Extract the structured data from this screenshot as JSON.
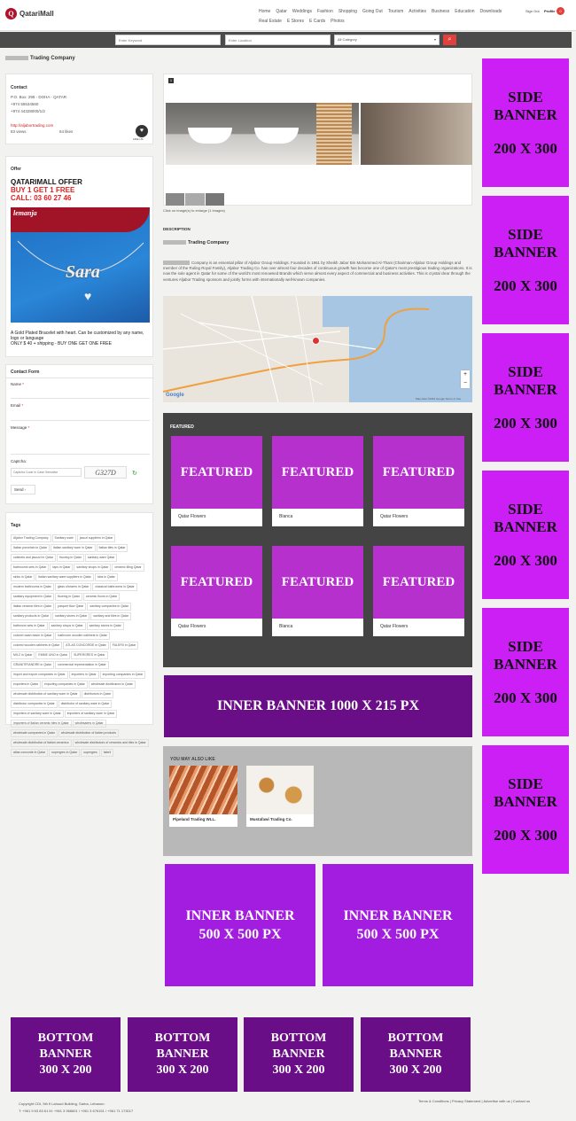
{
  "header": {
    "logo_text": "QatariMall",
    "logo_letter": "Q",
    "nav": [
      "Home",
      "Qatar",
      "Weddings",
      "Fashion",
      "Shopping",
      "Going Out",
      "Tourism",
      "Activities",
      "Business",
      "Education",
      "Downloads",
      "Real Estate",
      "E Stores",
      "E Cards",
      "Photos"
    ],
    "sign_out": "Sign Out",
    "profile": "Profile",
    "profile_badge": "0"
  },
  "search": {
    "keyword_placeholder": "Enter Keyword",
    "location_placeholder": "Enter Location",
    "category": "All Category"
  },
  "page": {
    "title_suffix": "Trading Company"
  },
  "contact": {
    "heading": "Contact",
    "address": "P.O. Box: 295 - DOHA - QATAR",
    "phone1": "+974 55534560",
    "phone2": "+974 44328000/1/2",
    "email": "",
    "website": "http://aljabortrading.com",
    "views": "83 views",
    "likes": "64 likes",
    "like_label": "LIKE US"
  },
  "offer": {
    "heading": "Offer",
    "title": "QATARIMALL OFFER",
    "line1": "BUY 1 GET 1 FREE",
    "line2": "CALL: 03 60 27 46",
    "brand": "lemanja",
    "pendant": "Sara",
    "desc1": "A Gold Plated Bracelet with heart. Can be customized by any name, logo or language",
    "desc2": "ONLY $ 40 + shipping - BUY ONE GET ONE FREE"
  },
  "form": {
    "heading": "Contact Form",
    "name": "Name",
    "email": "Email",
    "message": "Message",
    "captcha": "Captcha:",
    "captcha_placeholder": "Captcha Code is Case Sensitive",
    "captcha_code": "G327D",
    "send": "Send"
  },
  "tags": {
    "heading": "Tags",
    "items": [
      "Aljabor Trading Company",
      "Sanitary ware",
      "jacuzi suppliers in Qatar",
      "Italian porcelain in Qatar",
      "Italian sanitary ware in Qatar",
      "Italian tiles in Qatar",
      "cabinets and jacuzzi in Qatar",
      "flooring in Qatar",
      "sanitary ware Qatar",
      "bathrooms sets in Qatar",
      "taps in Qatar",
      "sanitary shops in Qatar",
      "ceramic tiling Qatar",
      "sinks in Qatar",
      "italian sanitary ware suppliers in Qatar",
      "tubs in Qatar",
      "modern bathrooms in Qatar",
      "glass showers in Qatar",
      "classical bathrooms in Qatar",
      "sanitary equipment in Qatar",
      "flooring in Qatar",
      "ceramic floors in Qatar",
      "italian ceramic tiles in Qatar",
      "parquet floor Qatar",
      "sanitary companies in Qatar",
      "sanitary products in Qatar",
      "sanitary stores in Qatar",
      "sanitary and tiles in Qatar",
      "bathroom sets in Qatar",
      "sanitary shops in Qatar",
      "sanitary stores in Qatar",
      "colored wash basin in Qatar",
      "bathroom wooden cabinets in Qatar",
      "colored wooden cabinets in Qatar",
      "ATLAS CONCORDE in Qatar",
      "FALERII in Qatar",
      "MILZ in Qatar",
      "EMME UNO in Qatar",
      "SUPERGRES in Qatar",
      "GRANITIFIANDRE in Qatar",
      "commercial representation in Qatar",
      "import and export companies in Qatar",
      "importers in Qatar",
      "importing companies in Qatar",
      "exporters in Qatar",
      "exporting companies in Qatar",
      "wholesale distributors in Qatar",
      "wholesale distribution of sanitary ware in Qatar",
      "distributors in Qatar",
      "distributor companies in Qatar",
      "distributor of sanitary ware in Qatar",
      "importers of sanitary ware in Qatar",
      "importers of sanitary ware in Qatar",
      "importers of Italian ceramic tiles in Qatar",
      "wholesalers in Qatar",
      "wholesale companies in Qatar",
      "wholesale distribution of Italian products",
      "wholesale distribution of Italian ceramics",
      "wholesale distributors of ceramics and tiles in Qatar",
      "atlas concorde in Qatar",
      "supergres in Qatar",
      "supergres",
      "falerii"
    ]
  },
  "gallery": {
    "badge": "1",
    "caption": "Click on image(s) to enlarge (1 images)"
  },
  "description": {
    "heading": "DESCRIPTION",
    "company_suffix": "Trading Company",
    "text": "Company is an essential pillar of Aljabor Group Holdings. Founded in 1961 by Sheikh Jabor Bin Mohammed Al-Thani (Chairman-Aljabor Group Holdings and member of the Ruling Royal Family), Aljabor Trading Co. has over almost four decades of continuous growth has become one of Qatar's most prestigious trading organizations. It is now the sole agent in Qatar for some of the world's most renowned Brands which serve almost every aspect of commercial and business activities. This is crystal clear through the ventures Aljabor Trading sponsors and jointly forms with internationally well-known companies."
  },
  "map": {
    "zoom_in": "+",
    "zoom_out": "−",
    "google": "Google",
    "footer": "Map data ©2016 Google   Terms of Use"
  },
  "featured": {
    "heading": "FEATURED",
    "label": "FEATURED",
    "items": [
      "Qatar Flowers",
      "Blanca",
      "Qatar Flowers",
      "Qatar Flowers",
      "Blanca",
      "Qatar Flowers"
    ]
  },
  "inner_wide": {
    "text": "INNER BANNER 1000 X 215 PX"
  },
  "also_like": {
    "heading": "YOU MAY ALSO LIKE",
    "items": [
      "Pipeland Trading WLL.",
      "Mustafawi Trading Co."
    ]
  },
  "inner_square": {
    "line1": "INNER BANNER",
    "line2": "500 X 500 PX"
  },
  "side_banner": {
    "line1": "SIDE",
    "line2": "BANNER",
    "line3": "200 X 300"
  },
  "bottom_banner": {
    "line1": "BOTTOM",
    "line2": "BANNER",
    "line3": "300 X 200"
  },
  "footer": {
    "copyright": "Copyright CDI, 5th fl Lahoud Building, Sarba, Lebanon.",
    "phones": "T: +961 9 63 83 61 M: +961 3 966601 / +961 3 676151 / +961 71 173017",
    "links": "Terms & Conditions | Privacy Statement | Advertise with us | Contact us"
  },
  "colors": {
    "accent": "#e1403b",
    "side_banner": "#cc1ff5",
    "featured": "#b530cc",
    "inner_wide": "#6a0e87",
    "inner_square": "#a31de0",
    "bottom": "#6a0e87"
  }
}
